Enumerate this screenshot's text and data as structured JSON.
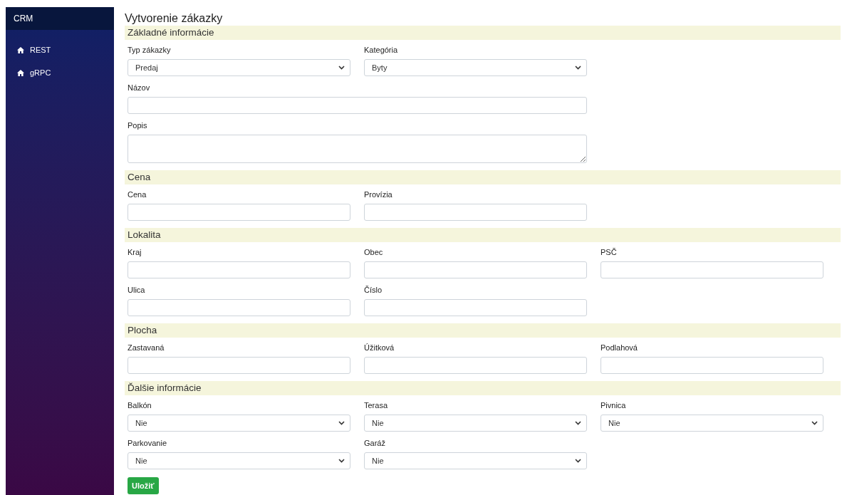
{
  "sidebar": {
    "brand": "CRM",
    "items": [
      {
        "label": "REST"
      },
      {
        "label": "gRPC"
      }
    ]
  },
  "page_title": "Vytvorenie zákazky",
  "sections": [
    {
      "title": "Základné informácie",
      "rows": [
        [
          {
            "kind": "select",
            "label": "Typ zákazky",
            "value": "Predaj"
          },
          {
            "kind": "select",
            "label": "Kategória",
            "value": "Byty"
          }
        ],
        [
          {
            "kind": "input",
            "label": "Názov",
            "wide": true
          }
        ],
        [
          {
            "kind": "textarea",
            "label": "Popis",
            "wide": true
          }
        ]
      ]
    },
    {
      "title": "Cena",
      "rows": [
        [
          {
            "kind": "input",
            "label": "Cena"
          },
          {
            "kind": "input",
            "label": "Provízia"
          }
        ]
      ]
    },
    {
      "title": "Lokalita",
      "rows": [
        [
          {
            "kind": "input",
            "label": "Kraj"
          },
          {
            "kind": "input",
            "label": "Obec"
          },
          {
            "kind": "input",
            "label": "PSČ"
          }
        ],
        [
          {
            "kind": "input",
            "label": "Ulica"
          },
          {
            "kind": "input",
            "label": "Číslo"
          }
        ]
      ]
    },
    {
      "title": "Plocha",
      "rows": [
        [
          {
            "kind": "input",
            "label": "Zastavaná"
          },
          {
            "kind": "input",
            "label": "Úžitková"
          },
          {
            "kind": "input",
            "label": "Podlahová"
          }
        ]
      ]
    },
    {
      "title": "Ďalšie informácie",
      "rows": [
        [
          {
            "kind": "select",
            "label": "Balkón",
            "value": "Nie"
          },
          {
            "kind": "select",
            "label": "Terasa",
            "value": "Nie"
          },
          {
            "kind": "select",
            "label": "Pivnica",
            "value": "Nie"
          }
        ],
        [
          {
            "kind": "select",
            "label": "Parkovanie",
            "value": "Nie"
          },
          {
            "kind": "select",
            "label": "Garáž",
            "value": "Nie"
          }
        ]
      ]
    }
  ],
  "save_button": "Uložiť"
}
